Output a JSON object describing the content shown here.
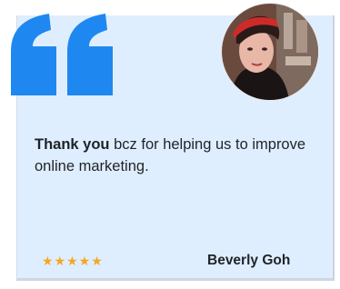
{
  "testimonial": {
    "message_bold": "Thank you",
    "message_rest": " bcz for helping us to improve online marketing.",
    "rating": 5,
    "stars": "★★★★★",
    "name": "Beverly Goh"
  },
  "icons": {
    "quote": "opening-quote-icon",
    "avatar": "profile-photo"
  },
  "colors": {
    "quote_mark": "#1f88f0",
    "card_background": "#dfeefe",
    "star": "#f5a623",
    "text": "#1f2328"
  }
}
